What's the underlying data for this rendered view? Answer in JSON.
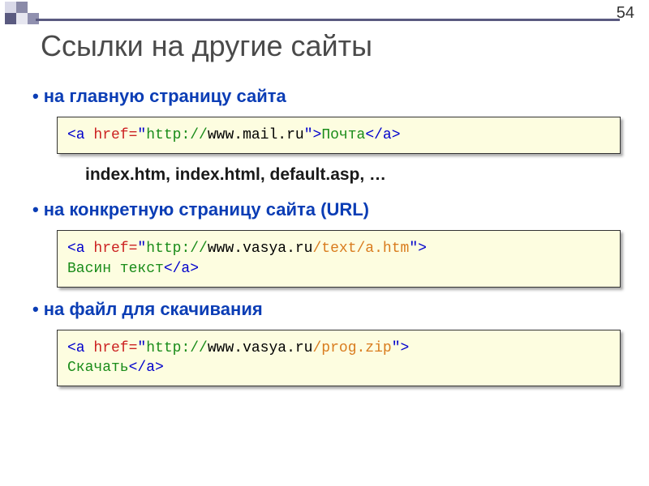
{
  "page_number": "54",
  "title": "Ссылки на другие сайты",
  "section1": {
    "heading": "на главную страницу сайта",
    "code_parts": {
      "open1": "<a ",
      "attr": "href=",
      "q1": "\"",
      "httpscheme": "http://",
      "domain": "www.mail.ru",
      "q2": "\"",
      "open2": ">",
      "text": "Почта",
      "close": "</a>"
    },
    "note": "index.htm, index.html, default.asp, …"
  },
  "section2": {
    "heading": "на конкретную страницу сайта (URL)",
    "code_parts": {
      "open1": "<a ",
      "attr": "href=",
      "q1": "\"",
      "httpscheme": "http://",
      "domain": "www.vasya.ru",
      "path": "/text/a.htm",
      "q2": "\"",
      "open2": ">",
      "br": "\n",
      "text": "Васин текст",
      "close": "</a>"
    }
  },
  "section3": {
    "heading": "на файл для скачивания",
    "code_parts": {
      "open1": "<a ",
      "attr": "href=",
      "q1": "\"",
      "httpscheme": "http://",
      "domain": "www.vasya.ru",
      "path": "/prog.zip",
      "q2": "\"",
      "open2": ">",
      "br": "\n",
      "text": "Скачать",
      "close": "</a>"
    }
  }
}
